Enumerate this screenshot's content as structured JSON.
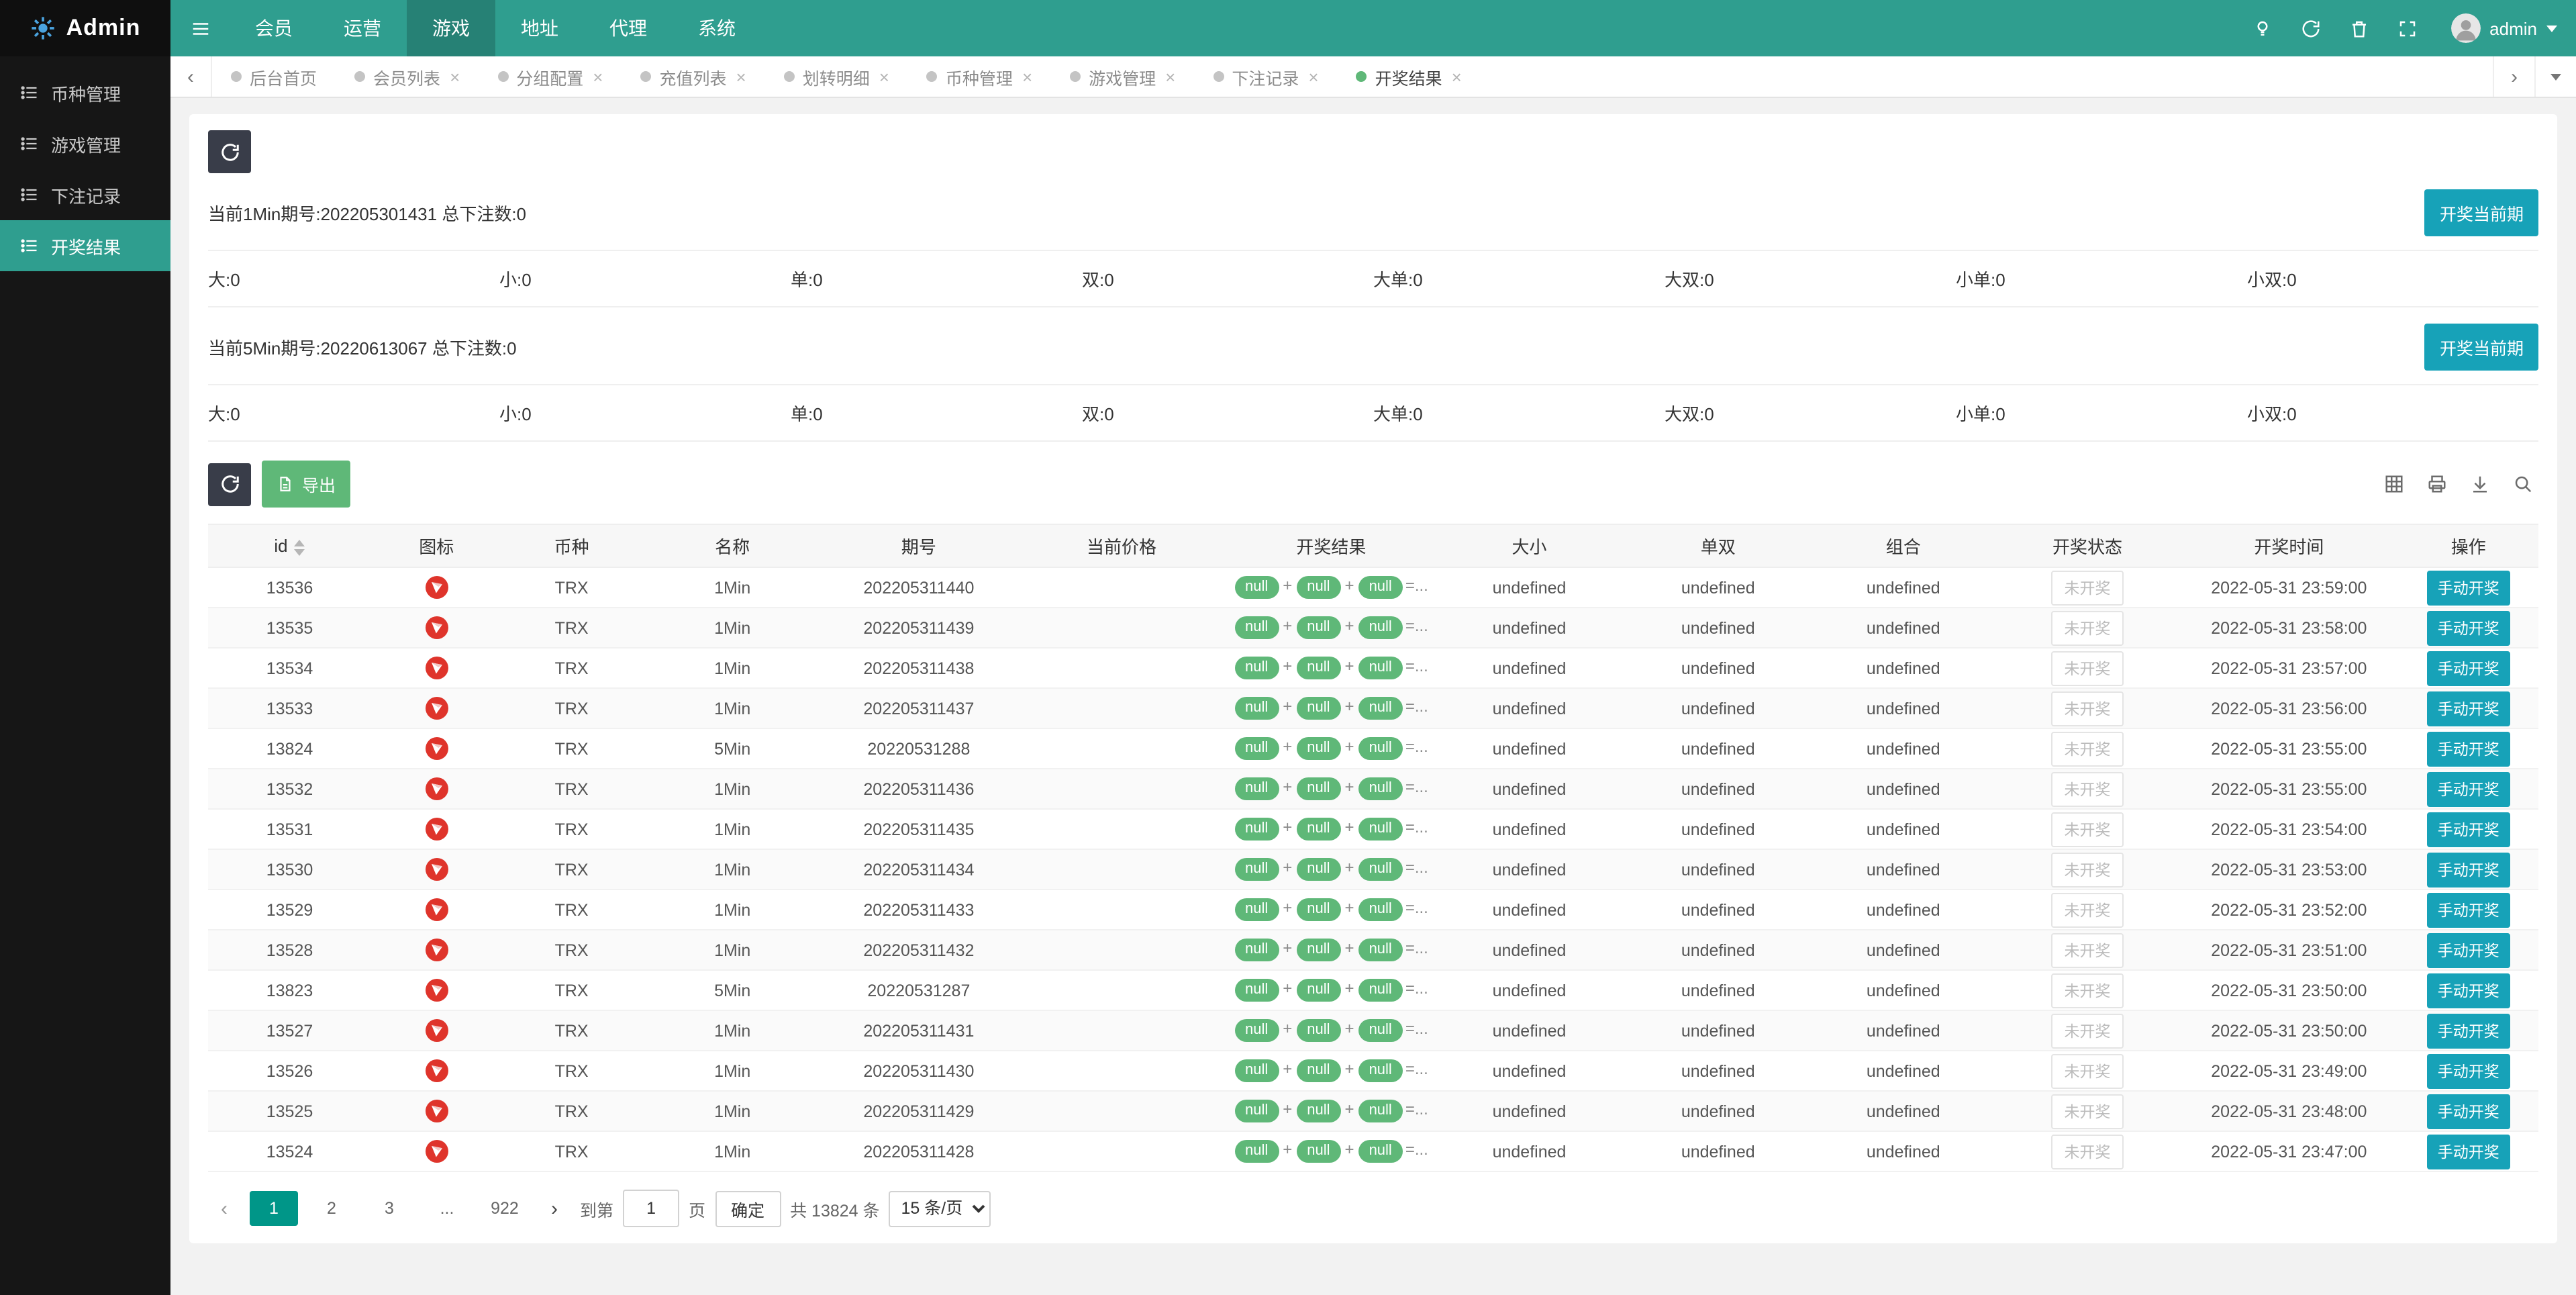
{
  "brand": {
    "name": "Admin"
  },
  "nav": {
    "items": [
      {
        "label": "会员"
      },
      {
        "label": "运营"
      },
      {
        "label": "游戏",
        "active": true
      },
      {
        "label": "地址"
      },
      {
        "label": "代理"
      },
      {
        "label": "系统"
      }
    ],
    "user": "admin"
  },
  "sidebar": {
    "items": [
      {
        "label": "币种管理"
      },
      {
        "label": "游戏管理"
      },
      {
        "label": "下注记录"
      },
      {
        "label": "开奖结果",
        "active": true
      }
    ]
  },
  "tabs": {
    "items": [
      {
        "label": "后台首页"
      },
      {
        "label": "会员列表",
        "closable": true
      },
      {
        "label": "分组配置",
        "closable": true
      },
      {
        "label": "充值列表",
        "closable": true
      },
      {
        "label": "划转明细",
        "closable": true
      },
      {
        "label": "币种管理",
        "closable": true
      },
      {
        "label": "游戏管理",
        "closable": true
      },
      {
        "label": "下注记录",
        "closable": true
      },
      {
        "label": "开奖结果",
        "closable": true,
        "active": true
      }
    ]
  },
  "icons": {
    "prev": "‹",
    "next": "›",
    "close": "×"
  },
  "panel": {
    "periods": [
      {
        "title": "当前1Min期号:202205301431 总下注数:0",
        "button": "开奖当前期",
        "stats": [
          "大:0",
          "小:0",
          "单:0",
          "双:0",
          "大单:0",
          "大双:0",
          "小单:0",
          "小双:0"
        ]
      },
      {
        "title": "当前5Min期号:20220613067 总下注数:0",
        "button": "开奖当前期",
        "stats": [
          "大:0",
          "小:0",
          "单:0",
          "双:0",
          "大单:0",
          "大双:0",
          "小单:0",
          "小双:0"
        ]
      }
    ]
  },
  "toolbar": {
    "export_label": "导出"
  },
  "table": {
    "columns": [
      {
        "label": "id",
        "sortable": true
      },
      {
        "label": "图标"
      },
      {
        "label": "币种"
      },
      {
        "label": "名称"
      },
      {
        "label": "期号"
      },
      {
        "label": "当前价格"
      },
      {
        "label": "开奖结果"
      },
      {
        "label": "大小"
      },
      {
        "label": "单双"
      },
      {
        "label": "组合"
      },
      {
        "label": "开奖状态"
      },
      {
        "label": "开奖时间"
      },
      {
        "label": "操作"
      }
    ],
    "result": {
      "pill": "null",
      "sep": "+",
      "suffix": "=..."
    },
    "action_label": "手动开奖",
    "rows": [
      {
        "id": "13536",
        "coin": "TRX",
        "name": "1Min",
        "issue": "202205311440",
        "price": "",
        "size": "undefined",
        "parity": "undefined",
        "combo": "undefined",
        "status": "未开奖",
        "time": "2022-05-31 23:59:00"
      },
      {
        "id": "13535",
        "coin": "TRX",
        "name": "1Min",
        "issue": "202205311439",
        "price": "",
        "size": "undefined",
        "parity": "undefined",
        "combo": "undefined",
        "status": "未开奖",
        "time": "2022-05-31 23:58:00"
      },
      {
        "id": "13534",
        "coin": "TRX",
        "name": "1Min",
        "issue": "202205311438",
        "price": "",
        "size": "undefined",
        "parity": "undefined",
        "combo": "undefined",
        "status": "未开奖",
        "time": "2022-05-31 23:57:00"
      },
      {
        "id": "13533",
        "coin": "TRX",
        "name": "1Min",
        "issue": "202205311437",
        "price": "",
        "size": "undefined",
        "parity": "undefined",
        "combo": "undefined",
        "status": "未开奖",
        "time": "2022-05-31 23:56:00"
      },
      {
        "id": "13824",
        "coin": "TRX",
        "name": "5Min",
        "issue": "20220531288",
        "price": "",
        "size": "undefined",
        "parity": "undefined",
        "combo": "undefined",
        "status": "未开奖",
        "time": "2022-05-31 23:55:00"
      },
      {
        "id": "13532",
        "coin": "TRX",
        "name": "1Min",
        "issue": "202205311436",
        "price": "",
        "size": "undefined",
        "parity": "undefined",
        "combo": "undefined",
        "status": "未开奖",
        "time": "2022-05-31 23:55:00"
      },
      {
        "id": "13531",
        "coin": "TRX",
        "name": "1Min",
        "issue": "202205311435",
        "price": "",
        "size": "undefined",
        "parity": "undefined",
        "combo": "undefined",
        "status": "未开奖",
        "time": "2022-05-31 23:54:00"
      },
      {
        "id": "13530",
        "coin": "TRX",
        "name": "1Min",
        "issue": "202205311434",
        "price": "",
        "size": "undefined",
        "parity": "undefined",
        "combo": "undefined",
        "status": "未开奖",
        "time": "2022-05-31 23:53:00"
      },
      {
        "id": "13529",
        "coin": "TRX",
        "name": "1Min",
        "issue": "202205311433",
        "price": "",
        "size": "undefined",
        "parity": "undefined",
        "combo": "undefined",
        "status": "未开奖",
        "time": "2022-05-31 23:52:00"
      },
      {
        "id": "13528",
        "coin": "TRX",
        "name": "1Min",
        "issue": "202205311432",
        "price": "",
        "size": "undefined",
        "parity": "undefined",
        "combo": "undefined",
        "status": "未开奖",
        "time": "2022-05-31 23:51:00"
      },
      {
        "id": "13823",
        "coin": "TRX",
        "name": "5Min",
        "issue": "20220531287",
        "price": "",
        "size": "undefined",
        "parity": "undefined",
        "combo": "undefined",
        "status": "未开奖",
        "time": "2022-05-31 23:50:00"
      },
      {
        "id": "13527",
        "coin": "TRX",
        "name": "1Min",
        "issue": "202205311431",
        "price": "",
        "size": "undefined",
        "parity": "undefined",
        "combo": "undefined",
        "status": "未开奖",
        "time": "2022-05-31 23:50:00"
      },
      {
        "id": "13526",
        "coin": "TRX",
        "name": "1Min",
        "issue": "202205311430",
        "price": "",
        "size": "undefined",
        "parity": "undefined",
        "combo": "undefined",
        "status": "未开奖",
        "time": "2022-05-31 23:49:00"
      },
      {
        "id": "13525",
        "coin": "TRX",
        "name": "1Min",
        "issue": "202205311429",
        "price": "",
        "size": "undefined",
        "parity": "undefined",
        "combo": "undefined",
        "status": "未开奖",
        "time": "2022-05-31 23:48:00"
      },
      {
        "id": "13524",
        "coin": "TRX",
        "name": "1Min",
        "issue": "202205311428",
        "price": "",
        "size": "undefined",
        "parity": "undefined",
        "combo": "undefined",
        "status": "未开奖",
        "time": "2022-05-31 23:47:00"
      }
    ]
  },
  "pagination": {
    "pages": [
      {
        "label": "1",
        "active": true
      },
      {
        "label": "2"
      },
      {
        "label": "3"
      },
      {
        "label": "...",
        "ellipsis": true
      },
      {
        "label": "922"
      }
    ],
    "jump_prefix": "到第",
    "jump_value": "1",
    "jump_suffix": "页",
    "confirm": "确定",
    "total": "共 13824 条",
    "page_size": "15 条/页"
  }
}
